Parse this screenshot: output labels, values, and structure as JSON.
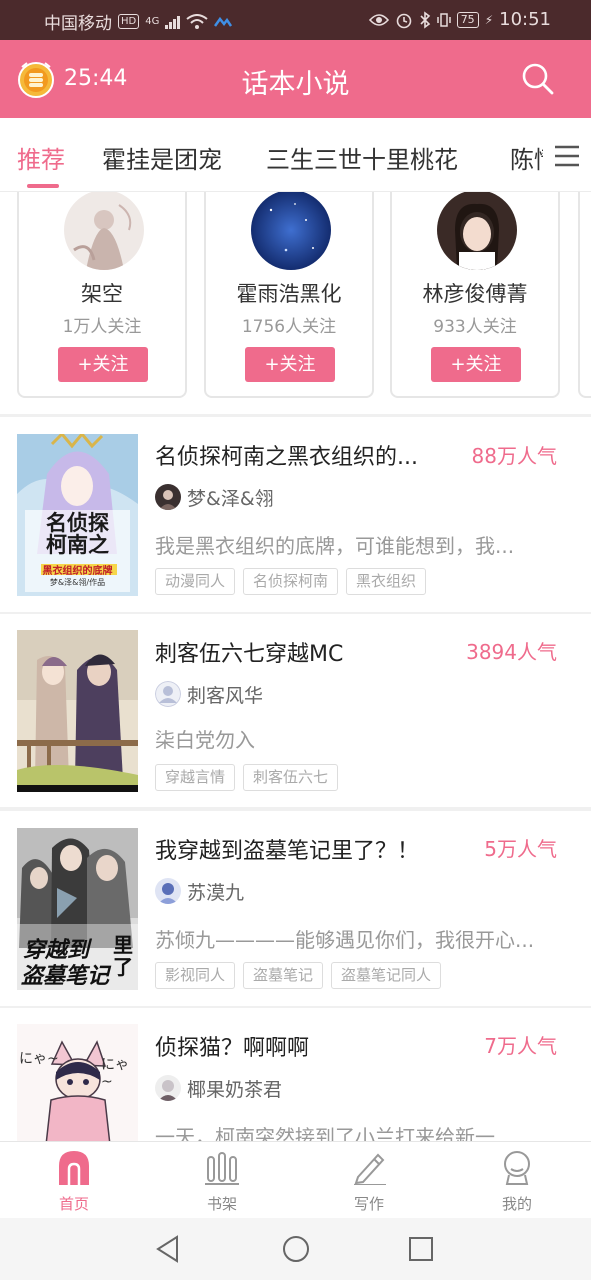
{
  "status_bar": {
    "carrier": "中国移动",
    "hd": "HD",
    "network": "4G",
    "battery": "75",
    "time": "10:51"
  },
  "header": {
    "timer": "25:44",
    "title": "话本小说",
    "icons": [
      "coin-timer-icon",
      "search-icon"
    ]
  },
  "tabs": [
    "推荐",
    "霍挂是团宠",
    "三生三世十里桃花",
    "陈情"
  ],
  "authors": [
    {
      "name": "架空",
      "followers": "1万人关注",
      "follow_label": "+关注"
    },
    {
      "name": "霍雨浩黑化",
      "followers": "1756人关注",
      "follow_label": "+关注"
    },
    {
      "name": "林彦俊傅菁",
      "followers": "933人关注",
      "follow_label": "+关注"
    }
  ],
  "books": [
    {
      "title": "名侦探柯南之黑衣组织的...",
      "popularity": "88万人气",
      "author": "梦&泽&翎",
      "desc": "我是黑衣组织的底牌，可谁能想到，我...",
      "tags": [
        "动漫同人",
        "名侦探柯南",
        "黑衣组织"
      ],
      "cover_text": [
        "名侦探",
        "柯南之",
        "黑衣组织的底牌",
        "梦&泽&翎/作品"
      ]
    },
    {
      "title": "刺客伍六七穿越MC",
      "popularity": "3894人气",
      "author": "刺客风华",
      "desc": "柒白党勿入",
      "tags": [
        "穿越言情",
        "刺客伍六七"
      ]
    },
    {
      "title": "我穿越到盗墓笔记里了？！",
      "popularity": "5万人气",
      "author": "苏漠九",
      "desc": "苏倾九————能够遇见你们，我很开心...",
      "tags": [
        "影视同人",
        "盗墓笔记",
        "盗墓笔记同人"
      ],
      "cover_text": [
        "穿越到",
        "盗墓笔记",
        "里了"
      ]
    },
    {
      "title": "侦探猫？啊啊啊",
      "popularity": "7万人气",
      "author": "椰果奶茶君",
      "desc": "一天，柯南突然接到了小兰打来给新一...",
      "tags": [],
      "cover_text": [
        "にゃ~",
        "にゃ~"
      ]
    }
  ],
  "bottom_nav": [
    {
      "label": "首页",
      "active": true,
      "icon": "home-icon"
    },
    {
      "label": "书架",
      "active": false,
      "icon": "bookshelf-icon"
    },
    {
      "label": "写作",
      "active": false,
      "icon": "pen-icon"
    },
    {
      "label": "我的",
      "active": false,
      "icon": "profile-icon"
    }
  ],
  "colors": {
    "accent": "#ef6b8c",
    "status_bar": "#4b2a2c"
  }
}
